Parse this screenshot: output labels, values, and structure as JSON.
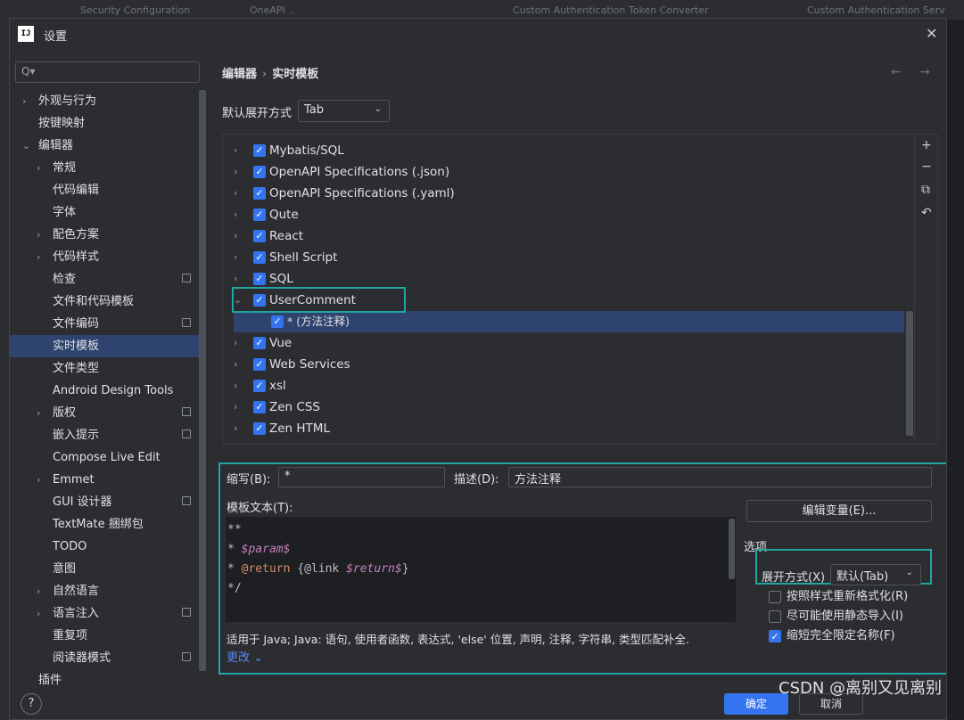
{
  "dialog": {
    "title": "设置",
    "logo_text": "IJ",
    "close_icon": "close-icon"
  },
  "background_tabs": [
    "Security Configuration",
    "OneAPI ..",
    "Custom Authentication Token Converter",
    "Custom Authentication Serv"
  ],
  "search": {
    "placeholder": "Q▾"
  },
  "sidebar": {
    "items": [
      {
        "label": "外观与行为",
        "chevron": "›"
      },
      {
        "label": "按键映射"
      },
      {
        "label": "编辑器",
        "chevron": "⌄"
      },
      {
        "label": "常规",
        "chevron": "›"
      },
      {
        "label": "代码编辑"
      },
      {
        "label": "字体"
      },
      {
        "label": "配色方案",
        "chevron": "›"
      },
      {
        "label": "代码样式",
        "chevron": "›"
      },
      {
        "label": "检查",
        "badge": true
      },
      {
        "label": "文件和代码模板"
      },
      {
        "label": "文件编码",
        "badge": true
      },
      {
        "label": "实时模板",
        "selected": true
      },
      {
        "label": "文件类型"
      },
      {
        "label": "Android Design Tools"
      },
      {
        "label": "版权",
        "chevron": "›",
        "badge": true
      },
      {
        "label": "嵌入提示",
        "badge": true
      },
      {
        "label": "Compose Live Edit"
      },
      {
        "label": "Emmet",
        "chevron": "›"
      },
      {
        "label": "GUI 设计器",
        "badge": true
      },
      {
        "label": "TextMate 捆绑包"
      },
      {
        "label": "TODO"
      },
      {
        "label": "意图"
      },
      {
        "label": "自然语言",
        "chevron": "›"
      },
      {
        "label": "语言注入",
        "chevron": "›",
        "badge": true
      },
      {
        "label": "重复项"
      },
      {
        "label": "阅读器模式",
        "badge": true
      },
      {
        "label": "插件"
      }
    ]
  },
  "breadcrumb": {
    "parent": "编辑器",
    "sep": "›",
    "current": "实时模板",
    "nav": "← →"
  },
  "expand": {
    "label": "默认展开方式",
    "value": "Tab"
  },
  "tree": {
    "rows": [
      {
        "label": "Mybatis/SQL",
        "chevron": "›"
      },
      {
        "label": "OpenAPI Specifications (.json)",
        "chevron": "›"
      },
      {
        "label": "OpenAPI Specifications (.yaml)",
        "chevron": "›"
      },
      {
        "label": "Qute",
        "chevron": "›"
      },
      {
        "label": "React",
        "chevron": "›"
      },
      {
        "label": "Shell Script",
        "chevron": "›"
      },
      {
        "label": "SQL",
        "chevron": "›"
      },
      {
        "label": "UserComment",
        "chevron": "⌄"
      },
      {
        "label": "* (方法注释)",
        "child": true,
        "selected": true
      },
      {
        "label": "Vue",
        "chevron": "›"
      },
      {
        "label": "Web Services",
        "chevron": "›"
      },
      {
        "label": "xsl",
        "chevron": "›"
      },
      {
        "label": "Zen CSS",
        "chevron": "›"
      },
      {
        "label": "Zen HTML",
        "chevron": "›"
      }
    ],
    "tools": [
      "+",
      "−",
      "⧉",
      "↶"
    ]
  },
  "detail": {
    "abbr_label": "缩写(B):",
    "abbr_value": "*",
    "desc_label": "描述(D):",
    "desc_value": "方法注释",
    "template_label": "模板文本(T):",
    "template_lines": [
      "**",
      "* $param$",
      "* @return {@link $return$}",
      "*/"
    ],
    "edit_vars_button": "编辑变量(E)...",
    "options_label": "选项",
    "expand_with_label": "展开方式(X)",
    "expand_with_value": "默认(Tab)",
    "options": [
      {
        "label": "按照样式重新格式化(R)",
        "checked": false
      },
      {
        "label": "尽可能使用静态导入(I)",
        "checked": false
      },
      {
        "label": "缩短完全限定名称(F)",
        "checked": true
      }
    ],
    "applies_to": "适用于 Java; Java: 语句, 使用者函数, 表达式, 'else' 位置, 声明, 注释, 字符串, 类型匹配补全.",
    "change_link": "更改 ⌄"
  },
  "footer": {
    "help": "?",
    "ok": "确定",
    "cancel": "取消"
  },
  "watermark": "CSDN @离别又见离别",
  "colors": {
    "accent": "#3574f0",
    "highlight": "#22a5a3",
    "selection": "#2e436e"
  }
}
